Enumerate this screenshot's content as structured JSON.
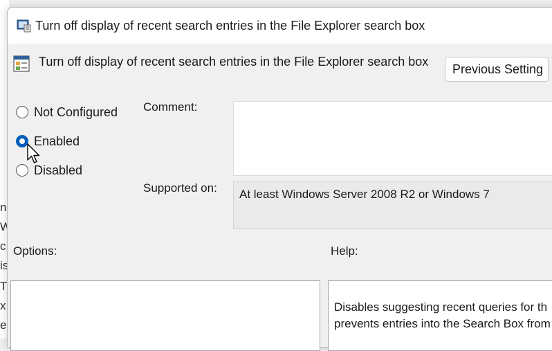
{
  "background_window": {
    "fragments": [
      "n",
      "Wi",
      "c",
      "is",
      "T",
      "x",
      "e"
    ]
  },
  "dialog": {
    "window_title": "Turn off display of recent search entries in the File Explorer search box",
    "policy_title": "Turn off display of recent search entries in the File Explorer search box",
    "previous_setting_label": "Previous Setting",
    "state": {
      "options": [
        {
          "label": "Not Configured",
          "checked": false
        },
        {
          "label": "Enabled",
          "checked": true
        },
        {
          "label": "Disabled",
          "checked": false
        }
      ]
    },
    "comment_label": "Comment:",
    "comment_value": "",
    "supported_on_label": "Supported on:",
    "supported_on_value": "At least Windows Server 2008 R2 or Windows 7",
    "options_label": "Options:",
    "help_label": "Help:",
    "help_lines": [
      "Disables suggesting recent queries for th",
      "prevents entries into the Search Box from"
    ]
  },
  "icons": {
    "title_icon": "policy-window-icon",
    "policy_icon": "policy-setting-icon",
    "cursor": "mouse-pointer-icon"
  },
  "colors": {
    "accent": "#005fb8",
    "titlebar": "#ffffff",
    "dialog_bg": "#f0f0f0"
  }
}
